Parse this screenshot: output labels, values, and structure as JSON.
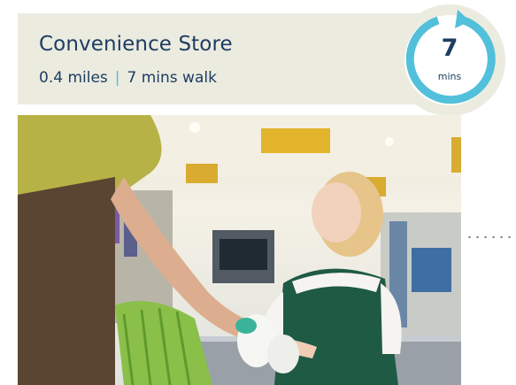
{
  "store": {
    "name": "Convenience Store",
    "distance": "0.4 miles",
    "separator": "|",
    "walk": "7 mins walk"
  },
  "badge": {
    "value": "7",
    "unit": "mins",
    "icon": "circular-arrow-icon"
  },
  "photo": {
    "icon": "shop-photo"
  },
  "colors": {
    "navy": "#1d3d62",
    "accent": "#52c0da",
    "panel": "#ebebdf"
  }
}
